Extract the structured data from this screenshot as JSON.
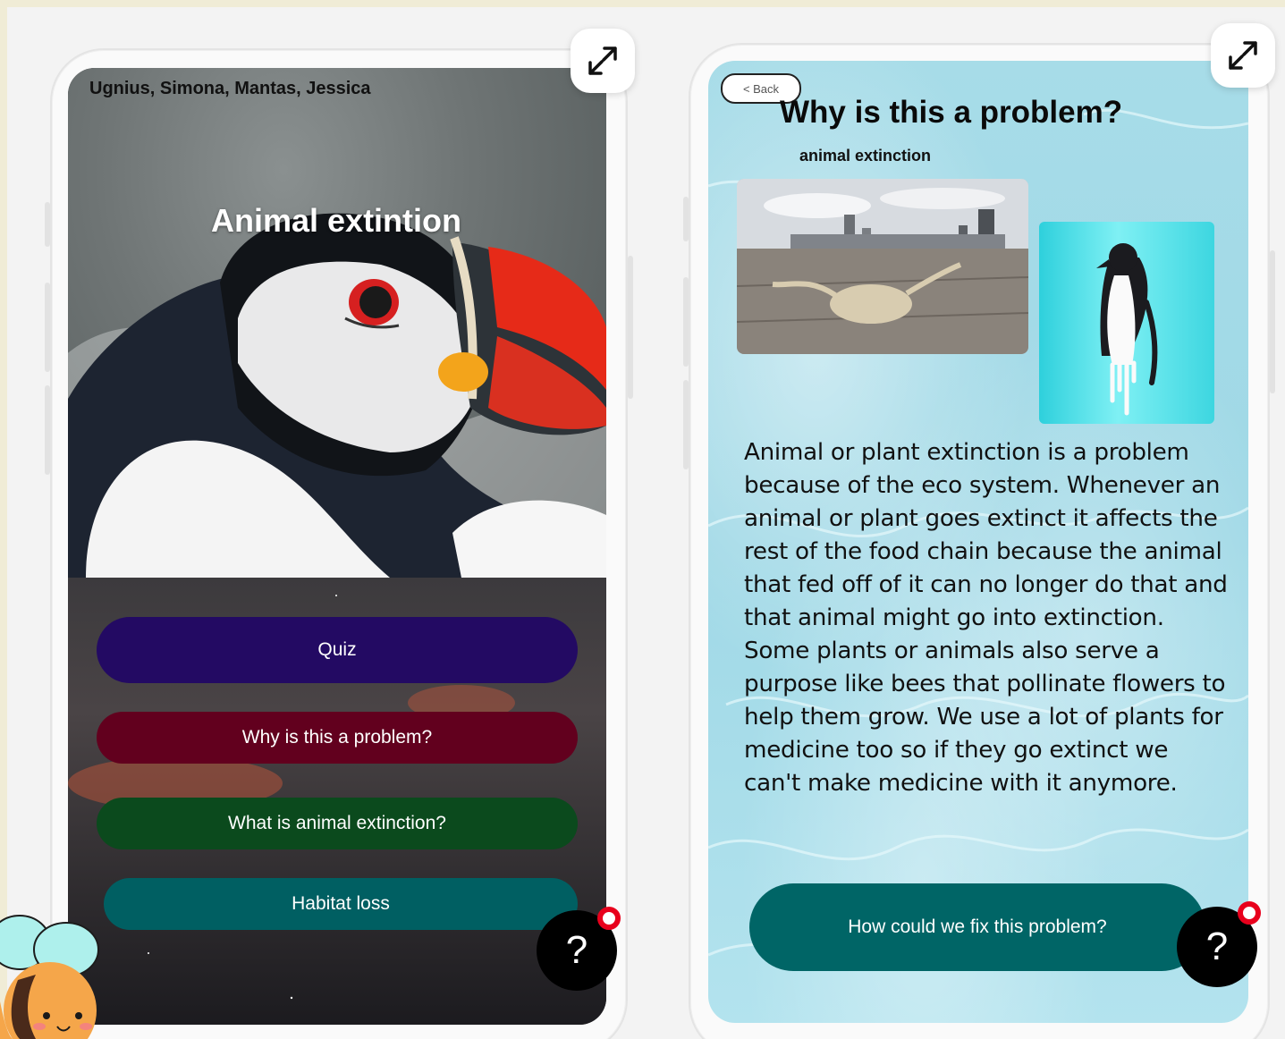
{
  "left_screen": {
    "members": "Ugnius, Simona, Mantas, Jessica",
    "title": "Animal extintion",
    "buttons": [
      {
        "label": "Quiz",
        "color": "#230a63"
      },
      {
        "label": "Why is this a problem?",
        "color": "#62001e"
      },
      {
        "label": "What is animal extinction?",
        "color": "#0b4a1d"
      },
      {
        "label": "Habitat loss",
        "color": "#005f62"
      }
    ],
    "help_label": "?"
  },
  "right_screen": {
    "back_label": "< Back",
    "title": "Why is this a problem?",
    "subtitle": "animal extinction",
    "body": "Animal or plant extinction is a problem because of the eco system. Whenever an animal or plant goes extinct it affects the rest of the food chain because the animal that fed off of it can no longer do that and that animal might go into extinction. Some plants or animals also serve a purpose like bees that pollinate flowers to help them grow. We use a lot of plants for medicine too so if they go extinct we can't make medicine with it anymore.",
    "fix_button": "How could we fix this problem?",
    "fix_button_color": "#006566",
    "help_label": "?"
  },
  "colors": {
    "frame_border": "#f0e08a",
    "notification": "#e8001c"
  }
}
